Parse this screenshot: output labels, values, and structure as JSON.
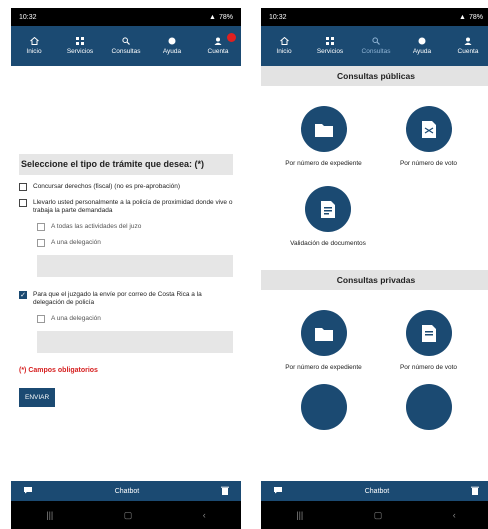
{
  "status_bar": {
    "time": "10:32",
    "battery": "78%"
  },
  "nav": {
    "items": [
      {
        "label": "Inicio",
        "icon": "home-icon"
      },
      {
        "label": "Servicios",
        "icon": "grid-icon"
      },
      {
        "label": "Consultas",
        "icon": "search-icon"
      },
      {
        "label": "Ayuda",
        "icon": "help-icon"
      },
      {
        "label": "Cuenta",
        "icon": "user-icon"
      }
    ]
  },
  "left": {
    "section_title": "Seleccione el tipo de trámite que desea: (*)",
    "option_1": "Concursar derechos (fiscal) (no es pre-aprobación)",
    "option_2": "Llevarlo usted personalmente a la policía de proximidad donde vive o trabaja la parte demandada",
    "sub_1a": "A todas las actividades del juzo",
    "sub_1b": "A una delegación",
    "option_3": "Para que el juzgado la envíe por correo de Costa Rica a la delegación de policía",
    "sub_3a": "A una delegación",
    "required_note": "(*) Campos obligatorios",
    "submit_label": "ENVIAR"
  },
  "right": {
    "public_title": "Consultas públicas",
    "public_tiles": [
      {
        "label": "Por número de expediente",
        "icon": "folder-icon"
      },
      {
        "label": "Por número de voto",
        "icon": "document-icon"
      },
      {
        "label": "Validación de documentos",
        "icon": "validate-document-icon"
      }
    ],
    "private_title": "Consultas privadas",
    "private_tiles": [
      {
        "label": "Por número de expediente",
        "icon": "folder-icon"
      },
      {
        "label": "Por número de voto",
        "icon": "document-icon"
      }
    ]
  },
  "bottom_bar": {
    "chatbot_label": "Chatbot"
  },
  "colors": {
    "primary": "#1b4a72",
    "required": "#d62020",
    "gray_band": "#e6e6e6"
  }
}
